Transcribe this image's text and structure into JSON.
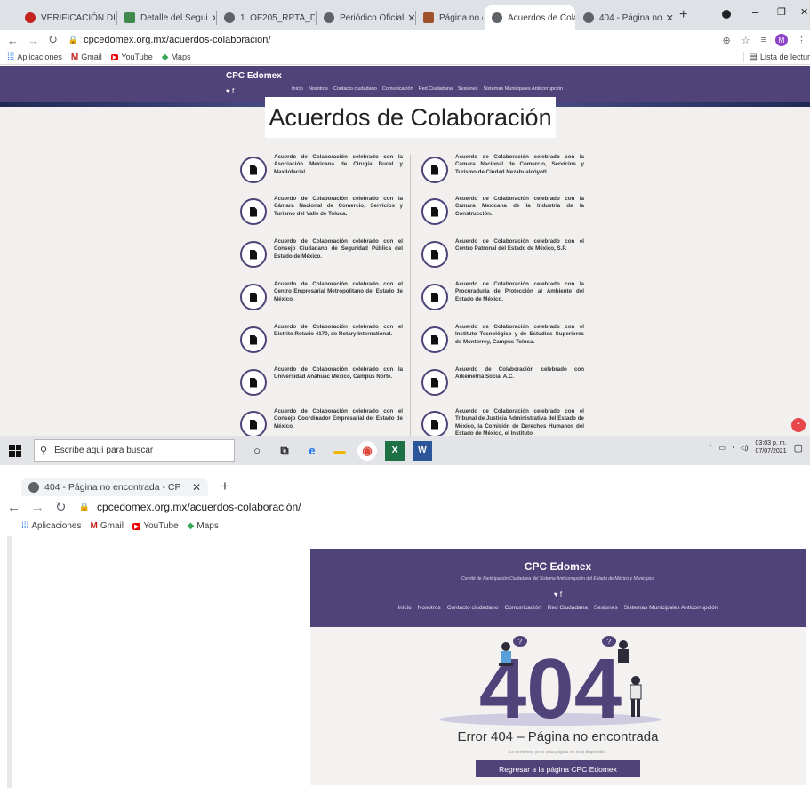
{
  "top_browser": {
    "tabs": [
      {
        "title": "VERIFICACIÓN DI",
        "icon": "gmail-icon"
      },
      {
        "title": "Detalle del Segui",
        "icon": "chart-icon"
      },
      {
        "title": "1. OF205_RPTA_D",
        "icon": "globe-icon"
      },
      {
        "title": "Periódico Oficial",
        "icon": "globe-icon"
      },
      {
        "title": "Página no encon",
        "icon": "archive-icon"
      },
      {
        "title": "Acuerdos de Cola",
        "icon": "globe-icon",
        "active": true
      },
      {
        "title": "404 - Página no",
        "icon": "globe-icon"
      }
    ],
    "url": "cpcedomex.org.mx/acuerdos-colaboracion/",
    "avatar": "M",
    "bookmarks": [
      "Aplicaciones",
      "Gmail",
      "YouTube",
      "Maps"
    ],
    "reading_list": "Lista de lectur"
  },
  "site1": {
    "brand": "CPC Edomex",
    "social": "♥  f",
    "nav": [
      "Inicio",
      "Nosotros",
      "Contacto ciudadano",
      "Comunicación",
      "Red Ciudadana",
      "Sesiones",
      "Sistemas Municipales Anticorrupción"
    ],
    "title": "Acuerdos de Colaboración",
    "agreements_left": [
      "Acuerdo de Colaboración celebrado con la Asociación Mexicana de Cirugía Bucal y Maxilofacial.",
      "Acuerdo de Colaboración celebrado con la Cámara Nacional de Comercio, Servicios y Turismo del Valle de Toluca.",
      "Acuerdo de Colaboración celebrado con el Consejo Ciudadano de Seguridad Pública del Estado de México.",
      "Acuerdo de Colaboración celebrado con el Centro Empresarial Metropolitano del Estado de México.",
      "Acuerdo de Colaboración celebrado con el Distrito Rotario 4170, de Rotary International.",
      "Acuerdo de Colaboración celebrado con la Universidad Anáhuac México, Campus Norte.",
      "Acuerdo de Colaboración celebrado con el Consejo Coordinador Empresarial del Estado de México."
    ],
    "agreements_right": [
      "Acuerdo de Colaboración celebrado con la Cámara Nacional de Comercio, Servicios y Turismo de Ciudad Nezahualcóyotl.",
      "Acuerdo de Colaboración celebrado con la Cámara Mexicana de la Industria de la Construcción.",
      "Acuerdo de Colaboración celebrado con el Centro Patronal del Estado de México, S.P.",
      "Acuerdo de Colaboración celebrado con la Procuraduría de Protección al Ambiente del Estado de México.",
      "Acuerdo de Colaboración celebrado con el Instituto Tecnológico y de Estudios Superiores de Monterrey, Campus Toluca.",
      "Acuerdo de Colaboración celebrado con Arkemetría Social A.C.",
      "Acuerdo de Colaboración celebrado con el Tribunal de Justicia Administrativa del Estado de México, la Comisión de Derechos Humanos del Estado de México, el Instituto"
    ]
  },
  "taskbar": {
    "search_placeholder": "Escribe aquí para buscar",
    "time": "03:03 p. m.",
    "date": "07/07/2021"
  },
  "bottom_browser": {
    "tab_title": "404 - Página no encontrada - CP",
    "url": "cpcedomex.org.mx/acuerdos-colaboración/",
    "bookmarks": [
      "Aplicaciones",
      "Gmail",
      "YouTube",
      "Maps"
    ]
  },
  "site2": {
    "brand": "CPC Edomex",
    "subtitle": "Comité de Participación Ciudadana del Sistema Anticorrupción del Estado de México y Municipios",
    "social": "♥  f",
    "nav": [
      "Inicio",
      "Nosotros",
      "Contacto ciudadano",
      "Comunicación",
      "Red Ciudadana",
      "Sesiones",
      "Sistemas Municipales Anticorrupción"
    ],
    "big_text": "404",
    "error_title": "Error 404 – Página no encontrada",
    "error_sub": "Lo sentimos, pero esta página no está disponible.",
    "back_button": "Regresar a la página CPC Edomex"
  },
  "colors": {
    "brand_purple": "#4f4379",
    "page_bg": "#f1f0ef"
  }
}
